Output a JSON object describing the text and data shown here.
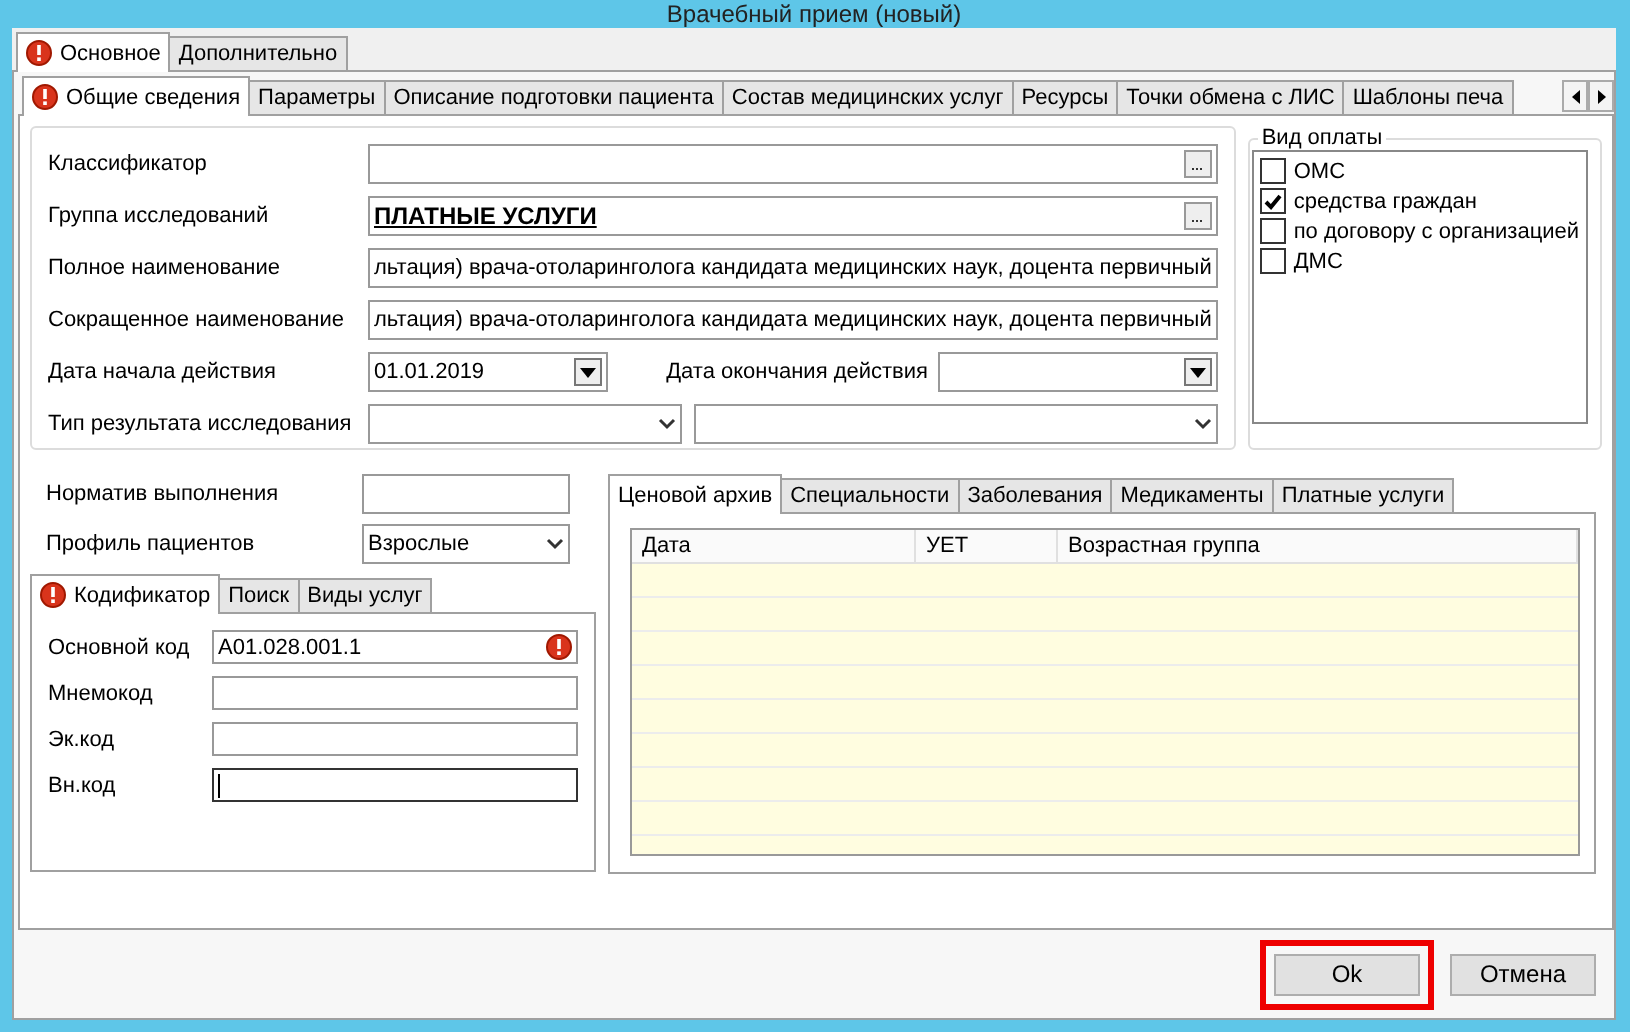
{
  "window": {
    "title": "Врачебный прием (новый)"
  },
  "main_tabs": [
    {
      "label": "Основное",
      "selected": true,
      "alert": true
    },
    {
      "label": "Дополнительно",
      "selected": false,
      "alert": false
    }
  ],
  "section_tabs": [
    {
      "label": "Общие сведения",
      "selected": true,
      "alert": true
    },
    {
      "label": "Параметры",
      "selected": false,
      "alert": false
    },
    {
      "label": "Описание подготовки пациента",
      "selected": false,
      "alert": false
    },
    {
      "label": "Состав медицинских услуг",
      "selected": false,
      "alert": false
    },
    {
      "label": "Ресурсы",
      "selected": false,
      "alert": false
    },
    {
      "label": "Точки обмена с ЛИС",
      "selected": false,
      "alert": false
    },
    {
      "label": "Шаблоны печа",
      "selected": false,
      "alert": false
    }
  ],
  "form": {
    "classifier": {
      "label": "Классификатор"
    },
    "research_group": {
      "label": "Группа исследований",
      "value": "ПЛАТНЫЕ УСЛУГИ"
    },
    "full_name": {
      "label": "Полное наименование",
      "value": "льтация) врача-отоларинголога кандидата медицинских наук, доцента первичный"
    },
    "short_name": {
      "label": "Сокращенное наименование",
      "value": "льтация) врача-отоларинголога кандидата медицинских наук, доцента первичный"
    },
    "start_date": {
      "label": "Дата начала действия",
      "value": "01.01.2019"
    },
    "end_date": {
      "label": "Дата окончания действия"
    },
    "result_type": {
      "label": "Тип результата исследования"
    }
  },
  "payment_type": {
    "title": "Вид оплаты",
    "options": [
      {
        "label": "ОМС",
        "checked": false
      },
      {
        "label": "средства граждан",
        "checked": true
      },
      {
        "label": "по договору с организацией",
        "checked": false
      },
      {
        "label": "ДМС",
        "checked": false
      }
    ]
  },
  "norm": {
    "label": "Норматив выполнения"
  },
  "patient_profile": {
    "label": "Профиль пациентов",
    "value": "Взрослые"
  },
  "code_tabs": [
    {
      "label": "Кодификатор",
      "selected": true,
      "alert": true
    },
    {
      "label": "Поиск",
      "selected": false,
      "alert": false
    },
    {
      "label": "Виды услуг",
      "selected": false,
      "alert": false
    }
  ],
  "codes": [
    {
      "label": "Основной код",
      "value": "A01.028.001.1",
      "alert": true,
      "focused": false
    },
    {
      "label": "Мнемокод",
      "alert": false,
      "focused": false
    },
    {
      "label": "Эк.код",
      "alert": false,
      "focused": false
    },
    {
      "label": "Вн.код",
      "alert": false,
      "focused": true
    }
  ],
  "archive_tabs": [
    {
      "label": "Ценовой архив",
      "selected": true
    },
    {
      "label": "Специальности",
      "selected": false
    },
    {
      "label": "Заболевания",
      "selected": false
    },
    {
      "label": "Медикаменты",
      "selected": false
    },
    {
      "label": "Платные услуги",
      "selected": false
    }
  ],
  "table": {
    "columns": [
      "Дата",
      "УЕТ",
      "Возрастная группа"
    ]
  },
  "buttons": [
    {
      "label": "Ok",
      "highlighted": true
    },
    {
      "label": "Отмена",
      "highlighted": false
    }
  ]
}
